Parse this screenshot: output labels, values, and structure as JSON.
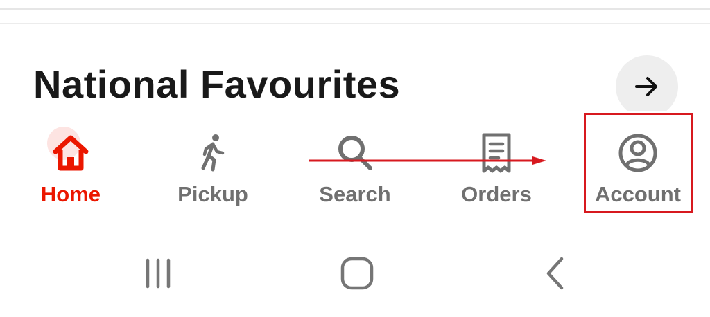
{
  "section": {
    "title": "National Favourites"
  },
  "nav": {
    "items": [
      {
        "label": "Home",
        "icon": "home-icon",
        "active": true
      },
      {
        "label": "Pickup",
        "icon": "walking-person-icon",
        "active": false
      },
      {
        "label": "Search",
        "icon": "search-icon",
        "active": false
      },
      {
        "label": "Orders",
        "icon": "receipt-icon",
        "active": false
      },
      {
        "label": "Account",
        "icon": "account-icon",
        "active": false
      }
    ]
  },
  "colors": {
    "accent": "#eb1700",
    "inactive": "#707070",
    "title": "#191919",
    "annotation": "#d7191f"
  },
  "system_nav": {
    "items": [
      "recents-icon",
      "home-icon",
      "back-icon"
    ]
  }
}
